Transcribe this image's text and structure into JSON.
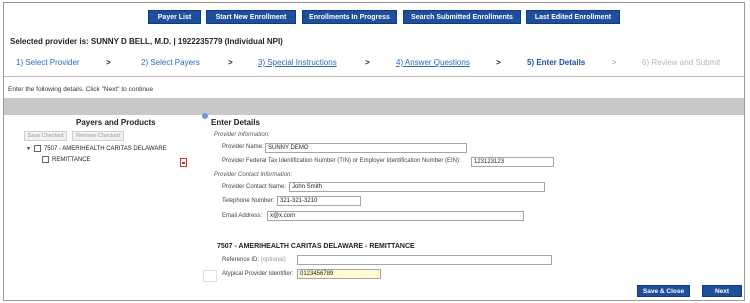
{
  "topnav": {
    "buttons": [
      "Payer List",
      "Start New Enrollment",
      "Enrollments In Progress",
      "Search Submitted Enrollments",
      "Last Edited Enrollment"
    ]
  },
  "selected_provider": "Selected provider is: SUNNY D BELL, M.D. | 1922235779 (Individual NPI)",
  "steps": {
    "items": [
      "1) Select Provider",
      "2) Select Payers",
      "3) Special Instructions",
      "4) Answer Questions",
      "5) Enter Details",
      "6) Review and Submit"
    ],
    "arrow": ">"
  },
  "instruction": "Enter the following details. Click \"Next\" to continue",
  "payers_panel": {
    "title": "Payers and Products",
    "save_checked": "Save Checked",
    "remove_checked": "Remove Checked",
    "payer_label": "7507 - AMERIHEALTH CARITAS DELAWARE",
    "product_label": "REMITTANCE",
    "pdf_icon": "pdf-icon"
  },
  "details": {
    "title": "Enter Details",
    "provider_info_heading": "Provider Information:",
    "provider_name_label": "Provider Name:",
    "provider_name_value": "SUNNY DEMO",
    "tin_label": "Provider Federal Tax Identification Number (TIN) or Employer Identification Number (EIN):",
    "tin_value": "123123123",
    "contact_heading": "Provider Contact Information:",
    "contact_name_label": "Provider Contact Name:",
    "contact_name_value": "John Smith",
    "phone_label": "Telephone Number:",
    "phone_value": "321-321-3210",
    "email_label": "Email Address:",
    "email_value": "x@x.com",
    "remittance_title": "7507 - AMERIHEALTH CARITAS DELAWARE - REMITTANCE",
    "reference_label": "Reference ID:",
    "reference_optional": "(optional)",
    "reference_value": "",
    "atypical_label": "Atypical Provider Identifier:",
    "atypical_value": "0123456789"
  },
  "footer": {
    "save_close": "Save & Close",
    "next": "Next"
  },
  "colors": {
    "nav_blue": "#1f4e9a",
    "link_blue": "#2a6ac0",
    "band_grey": "#c8c8c8",
    "highlight_yellow": "#fff8d2"
  }
}
